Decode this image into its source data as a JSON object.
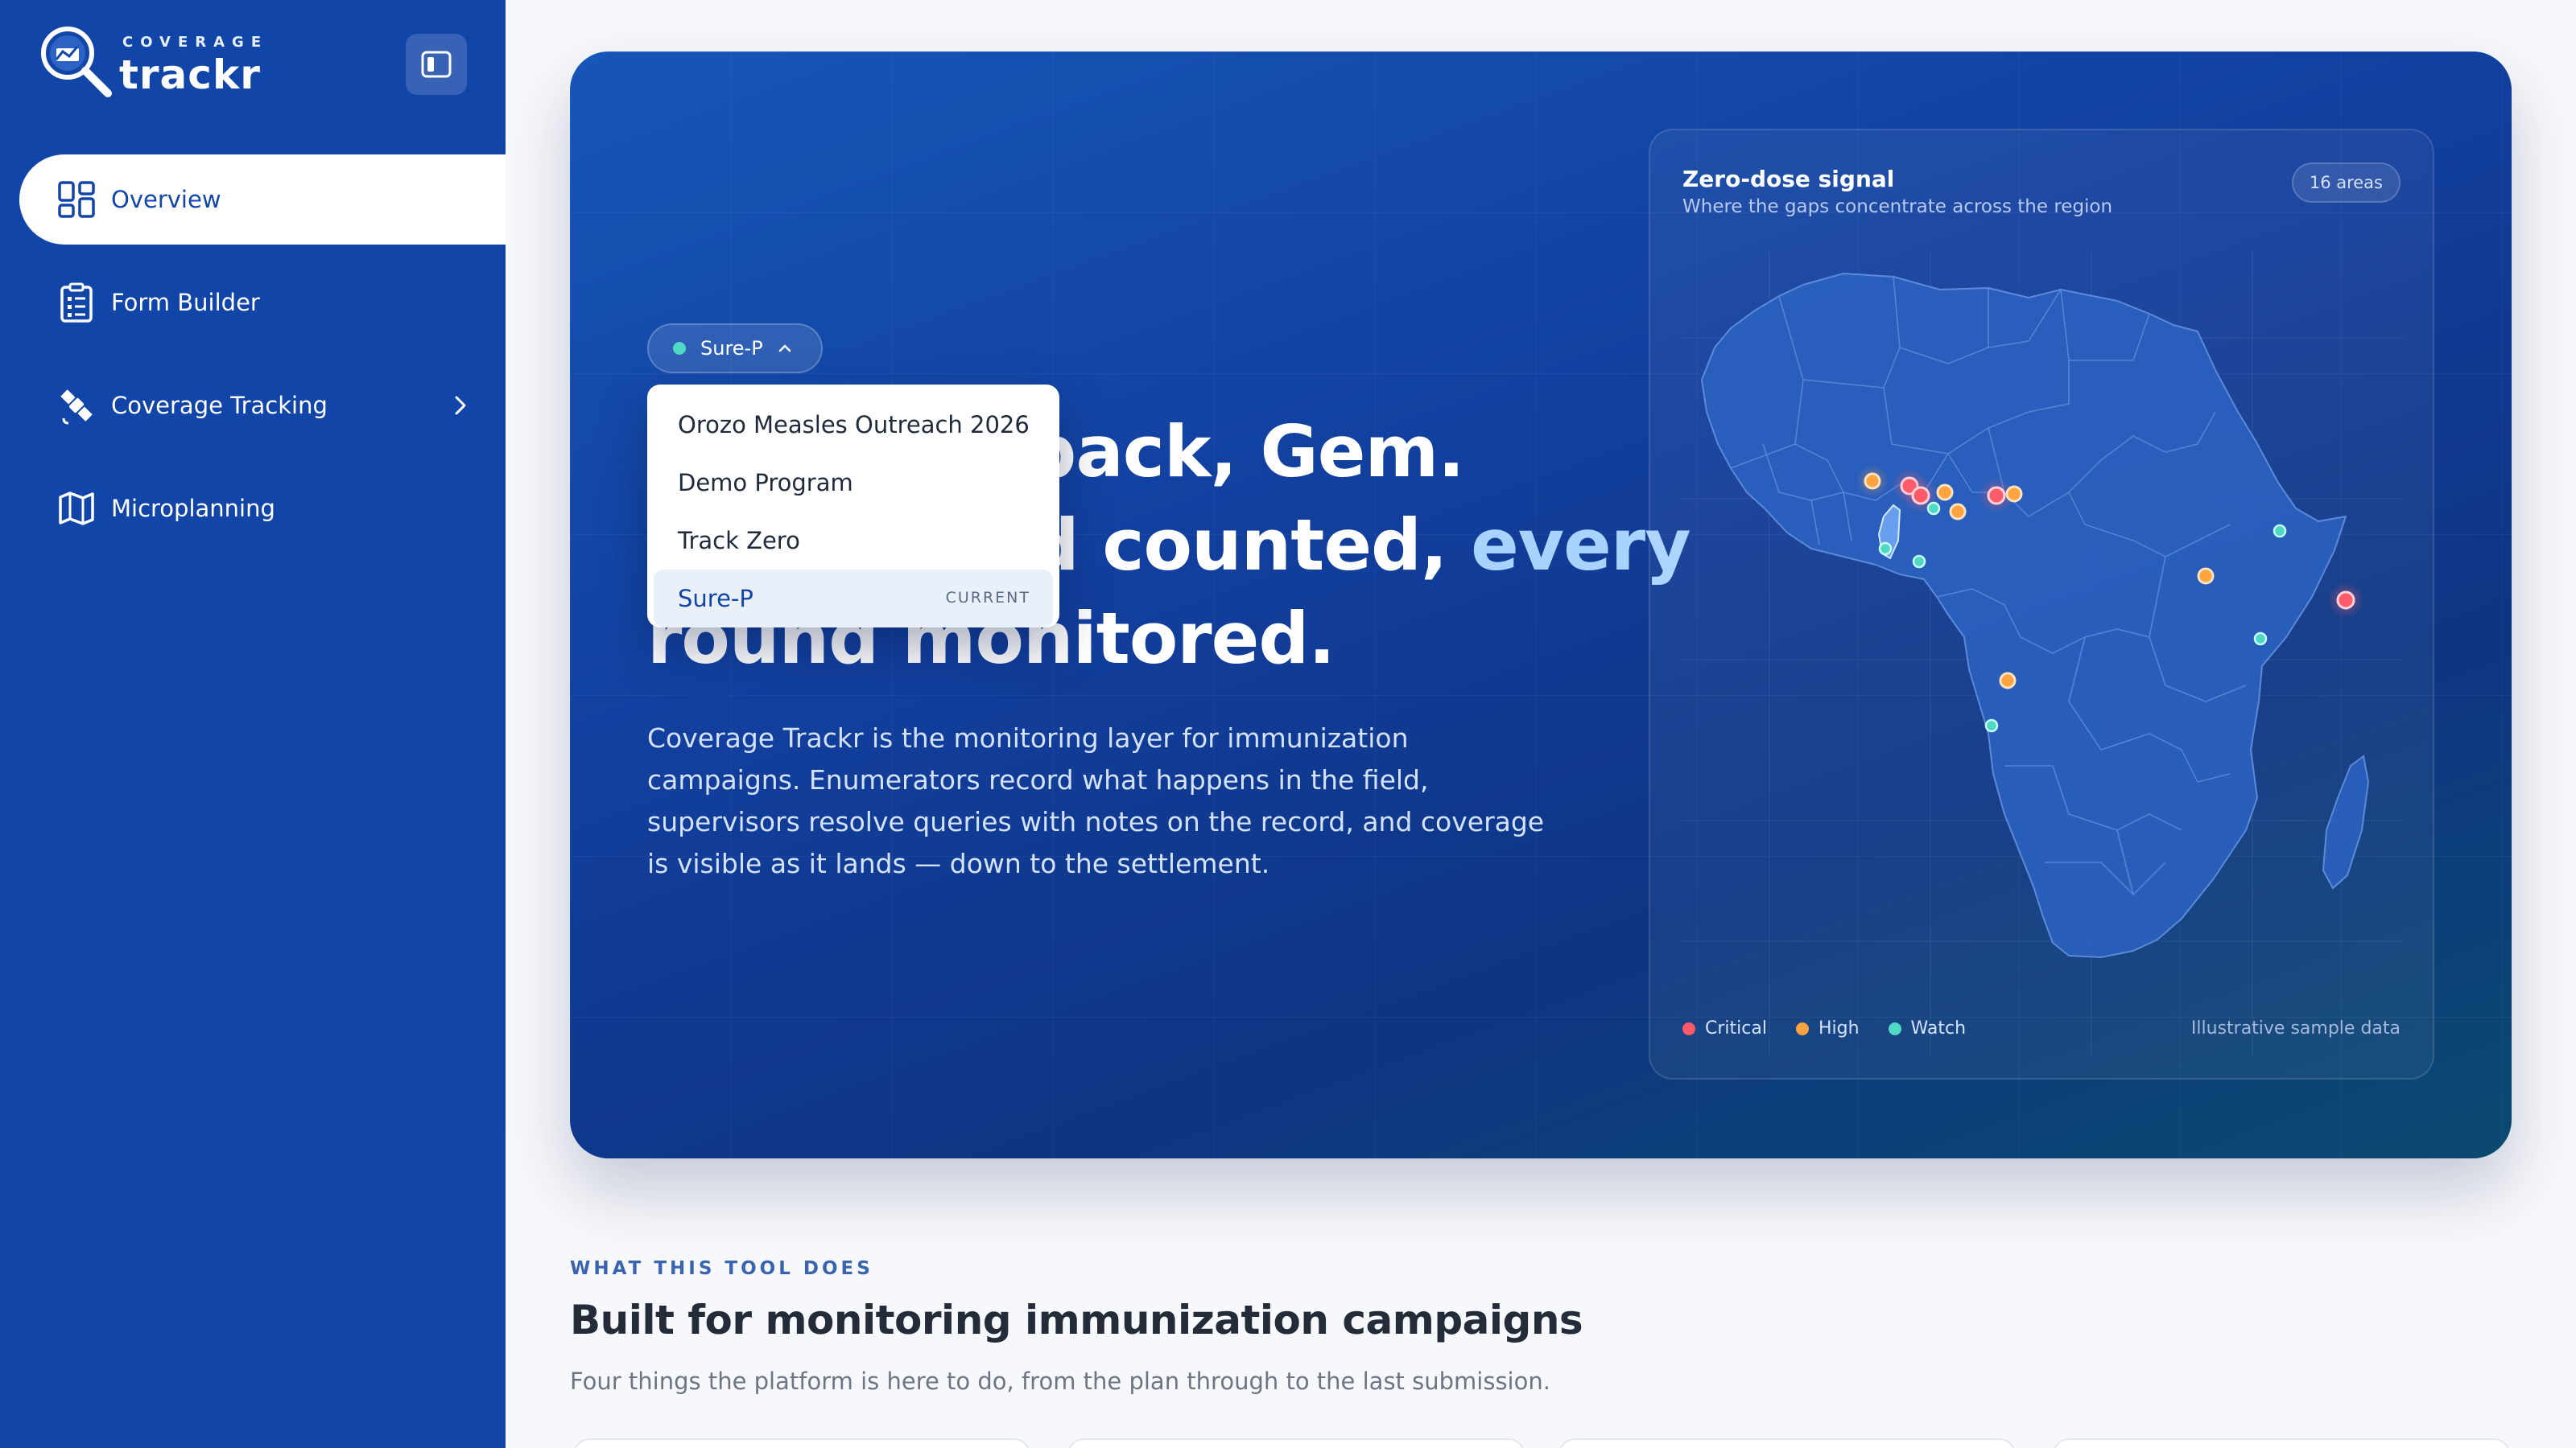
{
  "app": {
    "logo_small": "COVERAGE",
    "logo_big": "trackr"
  },
  "sidebar": {
    "items": [
      {
        "label": "Overview",
        "icon": "grid-icon",
        "active": true
      },
      {
        "label": "Form Builder",
        "icon": "clipboard-icon"
      },
      {
        "label": "Coverage Tracking",
        "icon": "satellite-icon",
        "has_submenu": true
      },
      {
        "label": "Microplanning",
        "icon": "map-icon"
      }
    ]
  },
  "hero": {
    "program_selected": "Sure-P",
    "headline_line1": "Welcome back, Gem.",
    "headline_line2a": "Every child counted,",
    "headline_line2b": "every",
    "headline_line3": "round monitored.",
    "description": "Coverage Trackr is the monitoring layer for immunization campaigns. Enumerators record what happens in the field, supervisors resolve queries with notes on the record, and coverage is visible as it lands — down to the settlement."
  },
  "program_dropdown": {
    "options": [
      "Orozo Measles Outreach 2026",
      "Demo Program",
      "Track Zero",
      "Sure-P"
    ],
    "current_index": 3,
    "current_tag": "CURRENT"
  },
  "map": {
    "title": "Zero-dose signal",
    "subtitle": "Where the gaps concentrate across the region",
    "badge": "16 areas",
    "legend": [
      {
        "label": "Critical",
        "color": "#ff5a6a"
      },
      {
        "label": "High",
        "color": "#ffa340"
      },
      {
        "label": "Watch",
        "color": "#4fd8c4"
      }
    ],
    "note": "Illustrative sample data"
  },
  "section": {
    "eyebrow": "WHAT THIS TOOL DOES",
    "title": "Built for monitoring immunization campaigns",
    "subtitle": "Four things the platform is here to do, from the plan through to the last submission."
  },
  "colors": {
    "sidebar": "#1245a8",
    "accent_light": "#a9d3ff",
    "critical": "#ff5a6a",
    "high": "#ffa340",
    "watch": "#4fd8c4"
  }
}
